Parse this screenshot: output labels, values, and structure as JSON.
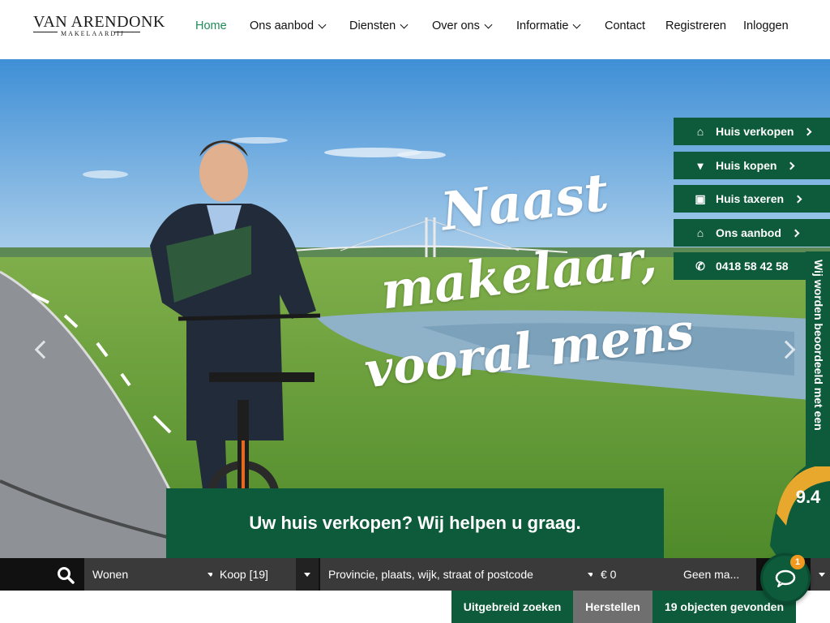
{
  "brand": {
    "name": "VAN ARENDONK",
    "tagline": "MAKELAARDIJ"
  },
  "nav": {
    "items": [
      {
        "label": "Home",
        "active": true,
        "dropdown": false
      },
      {
        "label": "Ons aanbod",
        "dropdown": true
      },
      {
        "label": "Diensten",
        "dropdown": true
      },
      {
        "label": "Over ons",
        "dropdown": true
      },
      {
        "label": "Informatie",
        "dropdown": true
      },
      {
        "label": "Contact",
        "dropdown": false
      },
      {
        "label": "Registreren",
        "dropdown": false
      },
      {
        "label": "Inloggen",
        "dropdown": false
      }
    ]
  },
  "hero": {
    "slogan": [
      "Naast",
      "makelaar,",
      "vooral mens"
    ],
    "banner": "Uw huis verkopen? Wij helpen u graag."
  },
  "quick_links": [
    {
      "label": "Huis verkopen",
      "icon": "home-icon",
      "glyph": "⌂"
    },
    {
      "label": "Huis kopen",
      "icon": "cart-icon",
      "glyph": "🛒"
    },
    {
      "label": "Huis taxeren",
      "icon": "money-icon",
      "glyph": "▣"
    },
    {
      "label": "Ons aanbod",
      "icon": "home-icon",
      "glyph": "⌂"
    },
    {
      "label": "0418 58 42 58",
      "icon": "phone-icon",
      "glyph": "✆"
    }
  ],
  "review": {
    "text": "Wij worden beoordeeld met een",
    "score": "9.4"
  },
  "search": {
    "type": "Wonen",
    "mode": "Koop [19]",
    "location_placeholder": "Provincie, plaats, wijk, straat of postcode",
    "price_min": "€ 0",
    "price_max": "Geen ma..."
  },
  "actions": {
    "advanced": "Uitgebreid zoeken",
    "reset": "Herstellen",
    "results": "19 objecten gevonden"
  },
  "chat": {
    "badge": "1"
  },
  "colors": {
    "primary_green": "#0e5b3b",
    "active_nav": "#1e8a57",
    "reset_gray": "#6f6f6f",
    "badge_orange": "#f29a1f"
  }
}
